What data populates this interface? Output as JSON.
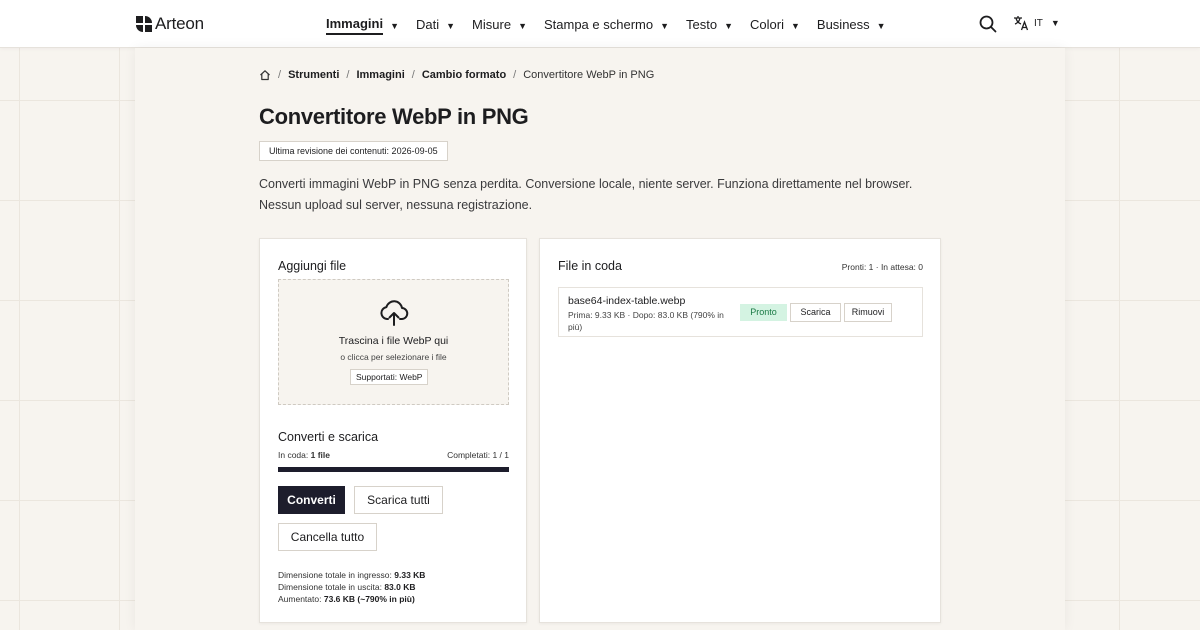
{
  "header": {
    "brand": "Arteon",
    "nav": [
      {
        "label": "Immagini",
        "active": true
      },
      {
        "label": "Dati"
      },
      {
        "label": "Misure"
      },
      {
        "label": "Stampa e schermo"
      },
      {
        "label": "Testo"
      },
      {
        "label": "Colori"
      },
      {
        "label": "Business"
      }
    ],
    "search_icon": "search-icon",
    "language": "IT",
    "language_icon": "translate-icon"
  },
  "breadcrumb": {
    "home_icon": "home-icon",
    "items": [
      "Strumenti",
      "Immagini",
      "Cambio formato"
    ],
    "current": "Convertitore WebP in PNG"
  },
  "page": {
    "title": "Convertitore WebP in PNG",
    "revision": "Ultima revisione dei contenuti: 2026-09-05",
    "description_line1": "Converti immagini WebP in PNG senza perdita. Conversione locale, niente server. Funziona direttamente nel browser.",
    "description_line2": "Nessun upload sul server, nessuna registrazione."
  },
  "upload": {
    "title": "Aggiungi file",
    "dropzone_icon": "cloud-upload-icon",
    "dropzone_title": "Trascina i file WebP qui",
    "dropzone_subtitle": "o clicca per selezionare i file",
    "supported": "Supportati: WebP"
  },
  "convert": {
    "title": "Converti e scarica",
    "queued_label": "In coda:",
    "queued_value": "1 file",
    "completed": "Completati: 1 / 1",
    "progress": 1.0,
    "convert_button": "Converti",
    "download_all_button": "Scarica tutti",
    "clear_button": "Cancella tutto",
    "total_in_label": "Dimensione totale in ingresso:",
    "total_in_value": "9.33 KB",
    "total_out_label": "Dimensione totale in uscita:",
    "total_out_value": "83.0 KB",
    "increase_label": "Aumentato:",
    "increase_value": "73.6 KB (~790% in più)"
  },
  "queue": {
    "title": "File in coda",
    "counts": "Pronti: 1 · In attesa: 0",
    "files": [
      {
        "name": "base64-index-table.webp",
        "meta": "Prima: 9.33 KB · Dopo: 83.0 KB (790% in più)",
        "status": "Pronto",
        "download": "Scarica",
        "remove": "Rimuovi"
      }
    ]
  },
  "colors": {
    "accent": "#1d1d2c",
    "ready_bg": "#d4f3e2",
    "ready_text": "#1a7a45",
    "background": "#f7f4ef"
  }
}
